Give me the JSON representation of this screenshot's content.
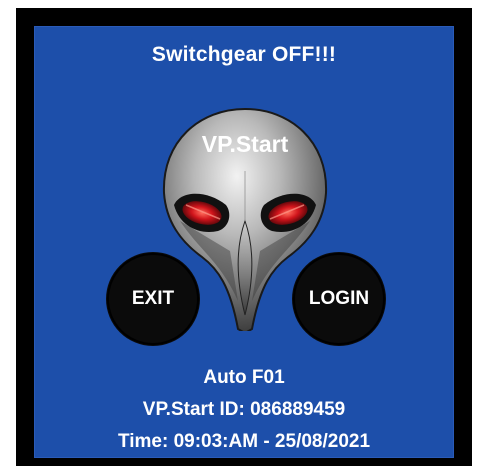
{
  "screen": {
    "title": "Switchgear OFF!!!",
    "logo_text": "VP.Start",
    "buttons": {
      "exit_label": "EXIT",
      "login_label": "LOGIN"
    },
    "info": {
      "mode": "Auto F01",
      "device_id": "VP.Start ID: 086889459",
      "time": "Time: 09:03:AM - 25/08/2021"
    }
  },
  "colors": {
    "background": "#1d4faa",
    "frame": "#000000",
    "text": "#ffffff",
    "eye_glow": "#d0141b"
  }
}
